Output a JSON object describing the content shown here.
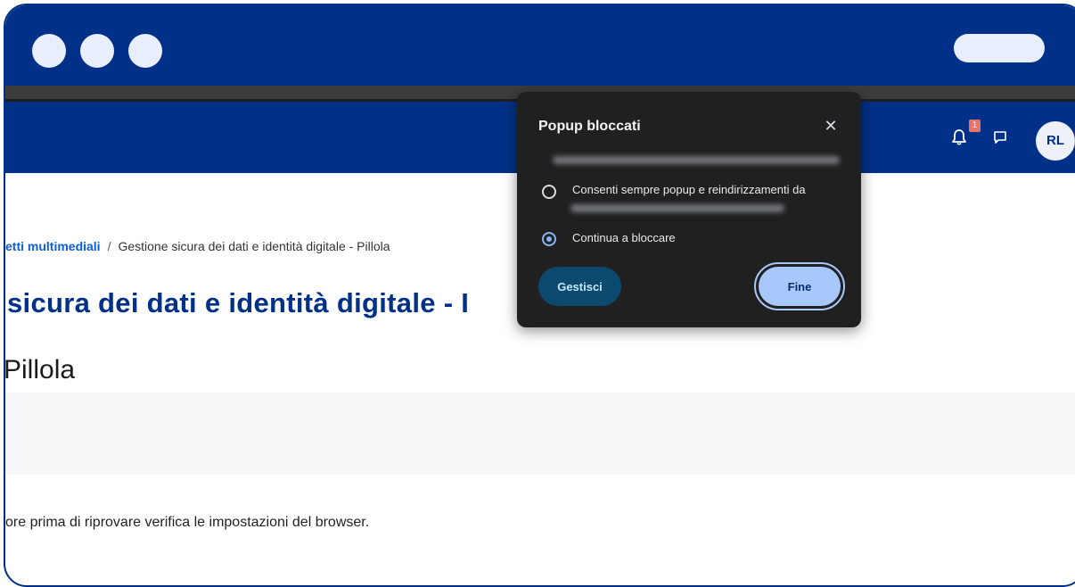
{
  "window": {
    "controls": [
      "window-dot-1",
      "window-dot-2",
      "window-dot-3"
    ]
  },
  "header": {
    "notification_count": "1",
    "avatar_initials": "RL",
    "icons": [
      "bell-icon",
      "chat-icon"
    ]
  },
  "breadcrumb": {
    "parent": "etti multimediali",
    "separator": "/",
    "current": "Gestione sicura dei dati e identità digitale - Pillola"
  },
  "page": {
    "title": "sicura dei dati e identità digitale - I",
    "subtitle": "Pillola",
    "message": "ore prima di riprovare verifica le impostazioni del browser."
  },
  "popup": {
    "title": "Popup bloccati",
    "close_icon": "close-icon",
    "options": [
      {
        "label": "Consenti sempre popup e reindirizzamenti da",
        "selected": false
      },
      {
        "label": "Continua a bloccare",
        "selected": true
      }
    ],
    "manage_label": "Gestisci",
    "done_label": "Fine"
  },
  "colors": {
    "brand_blue": "#003087",
    "popup_bg": "#202020",
    "primary_button": "#a8c7fa",
    "secondary_button": "#0b4a6e"
  }
}
